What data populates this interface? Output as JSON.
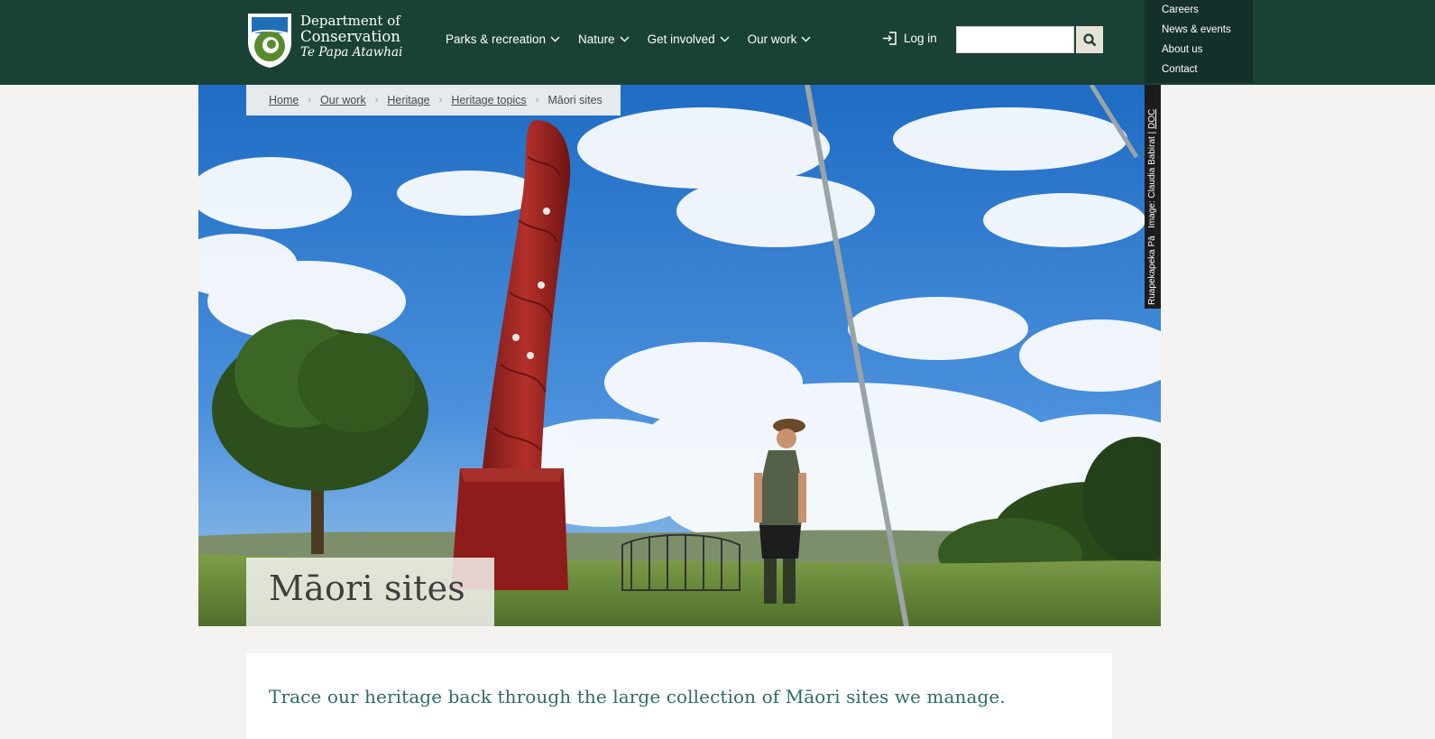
{
  "header": {
    "logo": {
      "line1": "Department of",
      "line2": "Conservation",
      "line3": "Te Papa Atawhai"
    },
    "nav": [
      {
        "label": "Parks & recreation"
      },
      {
        "label": "Nature"
      },
      {
        "label": "Get involved"
      },
      {
        "label": "Our work"
      }
    ],
    "login_label": "Log in",
    "search": {
      "value": "",
      "placeholder": ""
    },
    "secondary_nav": [
      {
        "label": "Careers"
      },
      {
        "label": "News & events"
      },
      {
        "label": "About us"
      },
      {
        "label": "Contact"
      }
    ]
  },
  "breadcrumb": {
    "items": [
      "Home",
      "Our work",
      "Heritage",
      "Heritage topics"
    ],
    "current": "Māori sites"
  },
  "hero": {
    "caption": "Ruapekapeka Pā",
    "credit_prefix": "Image: Claudia Babirat |",
    "credit_source": "DOC"
  },
  "page": {
    "title": "Māori sites",
    "intro": "Trace our heritage back through the large collection of Māori sites we manage."
  },
  "colors": {
    "header_bg": "#1a4136",
    "secondary_nav_bg": "#14302a",
    "page_bg": "#f4f3f1",
    "intro_text": "#2f6a66"
  }
}
